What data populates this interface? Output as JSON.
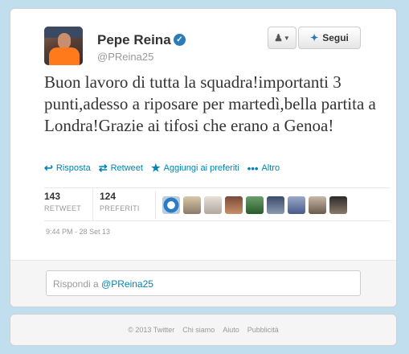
{
  "profile": {
    "name": "Pepe Reina",
    "handle": "@PReina25"
  },
  "buttons": {
    "follow_label": "Segui"
  },
  "tweet": {
    "text": "Buon lavoro di tutta la squadra!importanti 3 punti,adesso a riposare per martedì,bella partita a Londra!Grazie ai tifosi che erano a Genoa!"
  },
  "actions": [
    {
      "label": "Risposta",
      "icon": "reply-icon"
    },
    {
      "label": "Retweet",
      "icon": "retweet-icon"
    },
    {
      "label": "Aggiungi ai preferiti",
      "icon": "star-icon"
    },
    {
      "label": "Altro",
      "icon": "more-icon"
    }
  ],
  "stats": {
    "retweets": "143",
    "retweets_label": "RETWEET",
    "favorites": "124",
    "favorites_label": "PREFERITI"
  },
  "timestamp": "9:44 PM - 28 Set 13",
  "reply": {
    "prefix": "Rispondi a ",
    "mention": "@PReina25"
  },
  "footer": {
    "copyright": "© 2013 Twitter",
    "links": [
      "Chi siamo",
      "Aiuto",
      "Pubblicità"
    ]
  },
  "colors": {
    "link": "#0084b4",
    "verified": "#2b7bb9",
    "background": "#c0deed"
  }
}
